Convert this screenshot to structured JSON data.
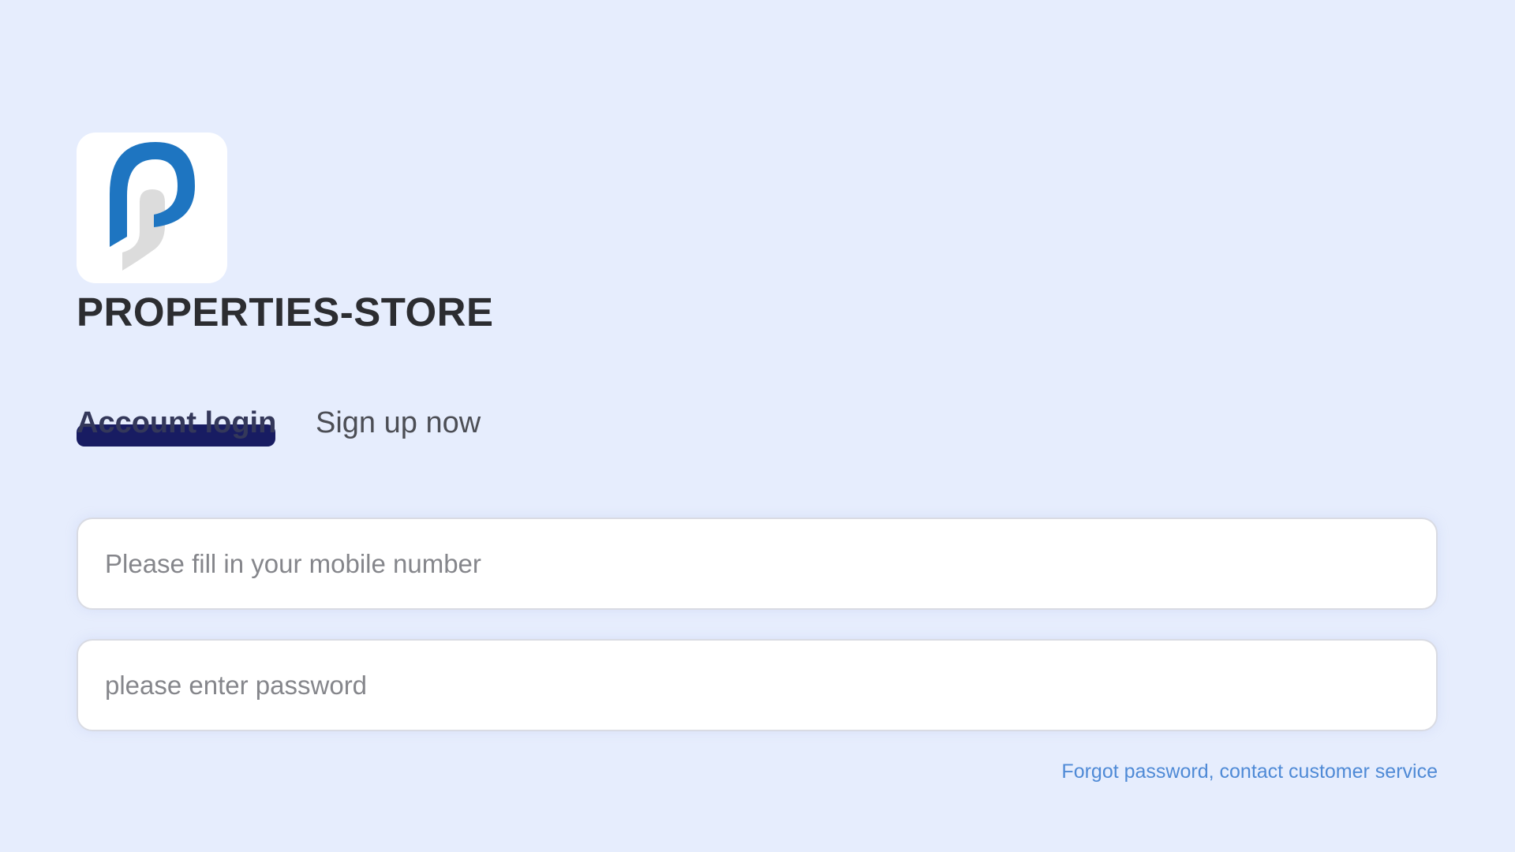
{
  "brand": {
    "logo_icon": "properties-store-p-logo",
    "title": "PROPERTIES-STORE",
    "colors": {
      "logo_blue": "#1e75c1",
      "logo_gray": "#dcdcdc"
    }
  },
  "tabs": [
    {
      "label": "Account login",
      "active": true
    },
    {
      "label": "Sign up now",
      "active": false
    }
  ],
  "form": {
    "phone_placeholder": "Please fill in your mobile number",
    "phone_value": "",
    "password_placeholder": "please enter password",
    "password_value": ""
  },
  "forgot_password_link": "Forgot password, contact customer service",
  "colors": {
    "background": "#e6edfd",
    "active_tab_indicator": "#181c62",
    "link": "#4f8ad6"
  }
}
